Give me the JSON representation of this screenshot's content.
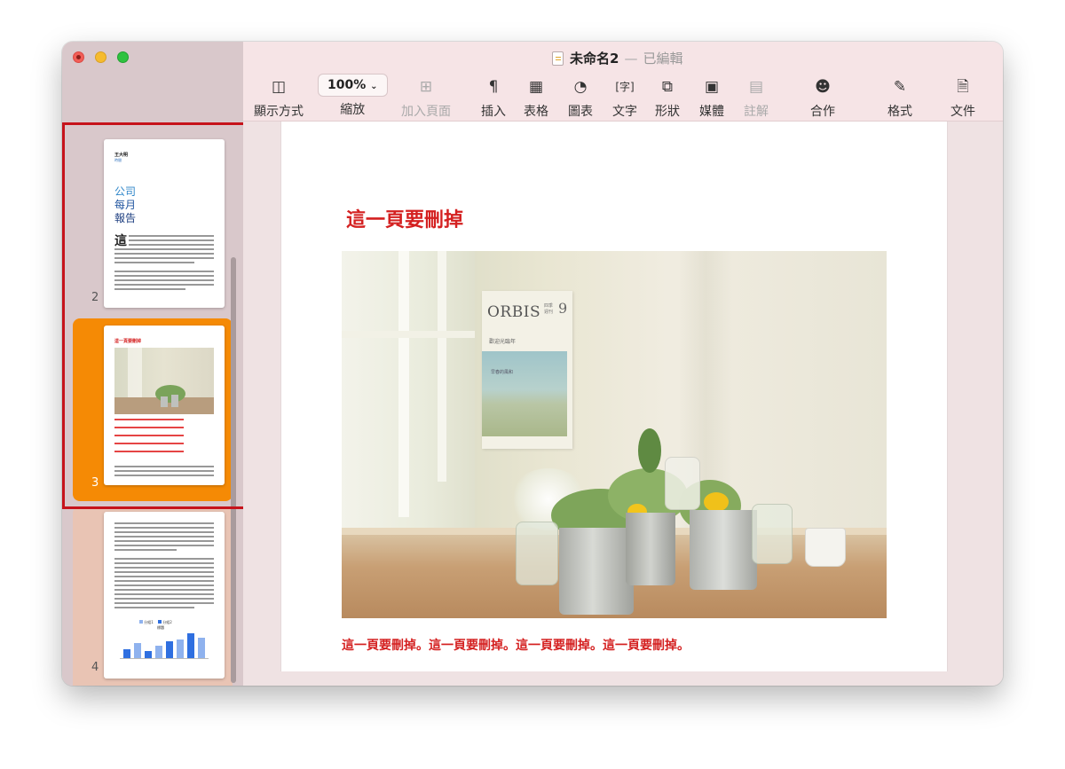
{
  "window": {
    "document_name": "未命名2",
    "separator": "—",
    "edit_state": "已編輯"
  },
  "toolbar": {
    "view_label": "顯示方式",
    "zoom_value": "100%",
    "zoom_label": "縮放",
    "add_page_label": "加入頁面",
    "insert_label": "插入",
    "table_label": "表格",
    "chart_label": "圖表",
    "text_label": "文字",
    "shape_label": "形狀",
    "media_label": "媒體",
    "comment_label": "註解",
    "collaborate_label": "合作",
    "format_label": "格式",
    "document_label": "文件"
  },
  "sidebar": {
    "pages": [
      {
        "number": "2",
        "author": "王大明",
        "date": "時間",
        "title_lines": [
          "公司",
          "每月",
          "報告"
        ],
        "dropcap": "這"
      },
      {
        "number": "3",
        "heading": "這一頁要刪掉",
        "selected": true
      },
      {
        "number": "4",
        "legend": [
          "分組1",
          "分組2"
        ],
        "chart_title": "標題",
        "bar_values": [
          0.32,
          0.55,
          0.28,
          0.48,
          0.62,
          0.7,
          0.92,
          0.78
        ]
      }
    ]
  },
  "page": {
    "heading": "這一頁要刪掉",
    "photo_text": {
      "brand": "ORBIS",
      "brand_sub": "四季 週刊",
      "issue": "9",
      "subtitle": "歡迎光臨年",
      "note": "早春的風和"
    },
    "body": "這一頁要刪掉。這一頁要刪掉。這一頁要刪掉。這一頁要刪掉。"
  },
  "colors": {
    "accent_red": "#d42020",
    "selection_orange": "#f58a05",
    "annotation_frame": "#c6131b"
  }
}
